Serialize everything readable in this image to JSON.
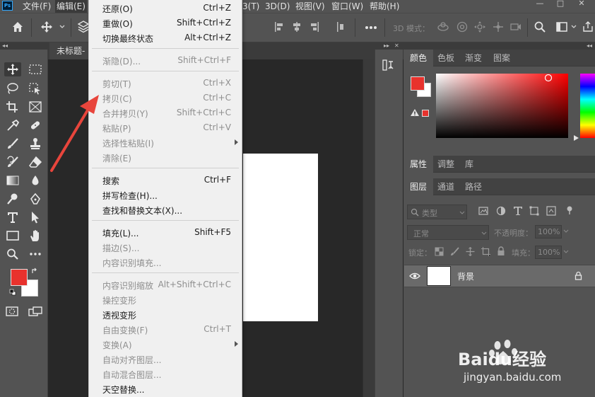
{
  "app": {
    "logo": "Ps"
  },
  "menubar": {
    "items": [
      "文件(F)",
      "编辑(E)",
      "3(T)",
      "3D(D)",
      "视图(V)",
      "窗口(W)",
      "帮助(H)"
    ],
    "window_controls": [
      "—",
      "□",
      "✕"
    ]
  },
  "options_bar": {
    "mode_3d_label": "3D 模式："
  },
  "document": {
    "tab_title": "未标题-"
  },
  "edit_menu": {
    "items": [
      {
        "label": "还原(O)",
        "shortcut": "Ctrl+Z",
        "enabled": true
      },
      {
        "label": "重做(O)",
        "shortcut": "Shift+Ctrl+Z",
        "enabled": true
      },
      {
        "label": "切换最终状态",
        "shortcut": "Alt+Ctrl+Z",
        "enabled": true
      },
      {
        "label": "渐隐(D)...",
        "shortcut": "Shift+Ctrl+F",
        "enabled": false
      },
      {
        "label": "剪切(T)",
        "shortcut": "Ctrl+X",
        "enabled": false
      },
      {
        "label": "拷贝(C)",
        "shortcut": "Ctrl+C",
        "enabled": false
      },
      {
        "label": "合并拷贝(Y)",
        "shortcut": "Shift+Ctrl+C",
        "enabled": false
      },
      {
        "label": "粘贴(P)",
        "shortcut": "Ctrl+V",
        "enabled": false
      },
      {
        "label": "选择性粘贴(I)",
        "shortcut": "",
        "enabled": false
      },
      {
        "label": "清除(E)",
        "shortcut": "",
        "enabled": false
      },
      {
        "label": "搜索",
        "shortcut": "Ctrl+F",
        "enabled": true
      },
      {
        "label": "拼写检查(H)...",
        "shortcut": "",
        "enabled": true
      },
      {
        "label": "查找和替换文本(X)...",
        "shortcut": "",
        "enabled": true
      },
      {
        "label": "填充(L)...",
        "shortcut": "Shift+F5",
        "enabled": true
      },
      {
        "label": "描边(S)...",
        "shortcut": "",
        "enabled": false
      },
      {
        "label": "内容识别填充...",
        "shortcut": "",
        "enabled": false
      },
      {
        "label": "内容识别缩放",
        "shortcut": "Alt+Shift+Ctrl+C",
        "enabled": false
      },
      {
        "label": "操控变形",
        "shortcut": "",
        "enabled": false
      },
      {
        "label": "透视变形",
        "shortcut": "",
        "enabled": true
      },
      {
        "label": "自由变换(F)",
        "shortcut": "Ctrl+T",
        "enabled": false
      },
      {
        "label": "变换(A)",
        "shortcut": "",
        "enabled": false
      },
      {
        "label": "自动对齐图层...",
        "shortcut": "",
        "enabled": false
      },
      {
        "label": "自动混合图层...",
        "shortcut": "",
        "enabled": false
      },
      {
        "label": "天空替换...",
        "shortcut": "",
        "enabled": true
      }
    ]
  },
  "color_panel": {
    "tabs": [
      "颜色",
      "色板",
      "渐变",
      "图案"
    ],
    "foreground": "#e8322d",
    "background": "#ffffff"
  },
  "properties_panel": {
    "tabs": [
      "属性",
      "调整",
      "库"
    ]
  },
  "layers_panel": {
    "tabs": [
      "图层",
      "通道",
      "路径"
    ],
    "filter_label": "类型",
    "blend_mode": "正常",
    "opacity_label": "不透明度：",
    "opacity_value": "100%",
    "lock_label": "锁定：",
    "fill_label": "填充：",
    "fill_value": "100%",
    "layers": [
      {
        "name": "背景",
        "visible": true,
        "locked": true
      }
    ]
  },
  "watermark": {
    "brand": "Baidu经验",
    "url": "jingyan.baidu.com"
  }
}
